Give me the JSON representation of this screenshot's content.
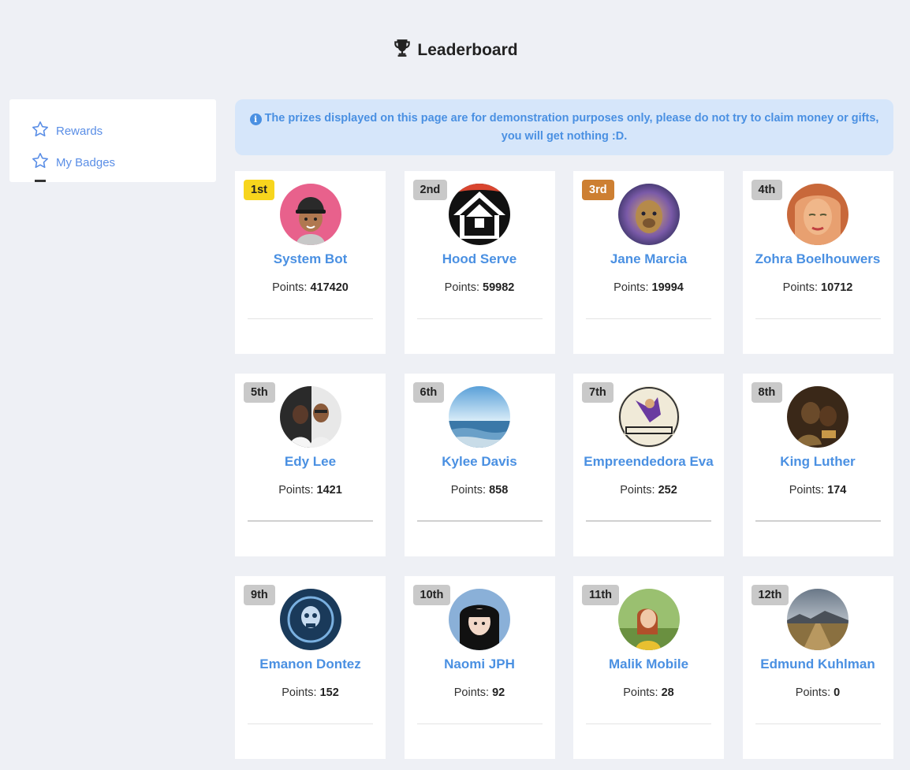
{
  "header": {
    "title": "Leaderboard"
  },
  "sidebar": {
    "items": [
      {
        "label": "Rewards"
      },
      {
        "label": "My Badges"
      }
    ]
  },
  "notice": {
    "text": "The prizes displayed on this page are for demonstration purposes only, please do not try to claim money or gifts, you will get nothing :D."
  },
  "points_label": "Points: ",
  "colors": {
    "accent": "#4a90e2",
    "gold": "#f7d51d",
    "silver": "#c9c9c9",
    "bronze": "#cd7f32",
    "background": "#eef0f5"
  },
  "leaderboard": [
    {
      "rank": "1st",
      "name": "System Bot",
      "points": "417420"
    },
    {
      "rank": "2nd",
      "name": "Hood Serve",
      "points": "59982"
    },
    {
      "rank": "3rd",
      "name": "Jane Marcia",
      "points": "19994"
    },
    {
      "rank": "4th",
      "name": "Zohra Boelhouwers",
      "points": "10712"
    },
    {
      "rank": "5th",
      "name": "Edy Lee",
      "points": "1421"
    },
    {
      "rank": "6th",
      "name": "Kylee Davis",
      "points": "858"
    },
    {
      "rank": "7th",
      "name": "Empreendedora Eva",
      "points": "252"
    },
    {
      "rank": "8th",
      "name": "King Luther",
      "points": "174"
    },
    {
      "rank": "9th",
      "name": "Emanon Dontez",
      "points": "152"
    },
    {
      "rank": "10th",
      "name": "Naomi JPH",
      "points": "92"
    },
    {
      "rank": "11th",
      "name": "Malik Mobile",
      "points": "28"
    },
    {
      "rank": "12th",
      "name": "Edmund Kuhlman",
      "points": "0"
    }
  ]
}
